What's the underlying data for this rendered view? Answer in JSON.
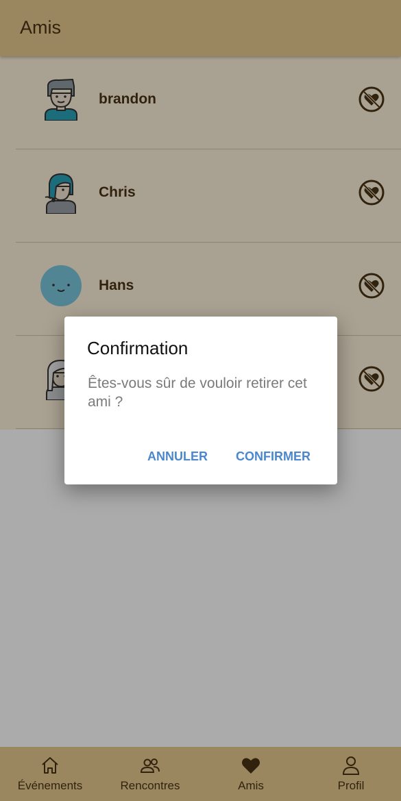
{
  "appbar": {
    "title": "Amis"
  },
  "friends": [
    {
      "name": "brandon",
      "avatar": "male-avatar-icon"
    },
    {
      "name": "Chris",
      "avatar": "teal-hair-avatar-icon"
    },
    {
      "name": "Hans",
      "avatar": "smiley-avatar-icon"
    },
    {
      "name": "",
      "avatar": "long-hair-avatar-icon"
    }
  ],
  "dialog": {
    "title": "Confirmation",
    "message": "Êtes-vous sûr de vouloir retirer cet ami ?",
    "cancel_label": "ANNULER",
    "confirm_label": "CONFIRMER"
  },
  "nav": {
    "items": [
      {
        "label": "Événements",
        "icon": "home-icon"
      },
      {
        "label": "Rencontres",
        "icon": "people-icon"
      },
      {
        "label": "Amis",
        "icon": "heart-icon"
      },
      {
        "label": "Profil",
        "icon": "person-icon"
      }
    ]
  },
  "colors": {
    "appbar": "#e8c98e",
    "list_background": "#fdf0d8",
    "text_brown": "#4a3414",
    "dialog_button": "#4a87cc"
  }
}
